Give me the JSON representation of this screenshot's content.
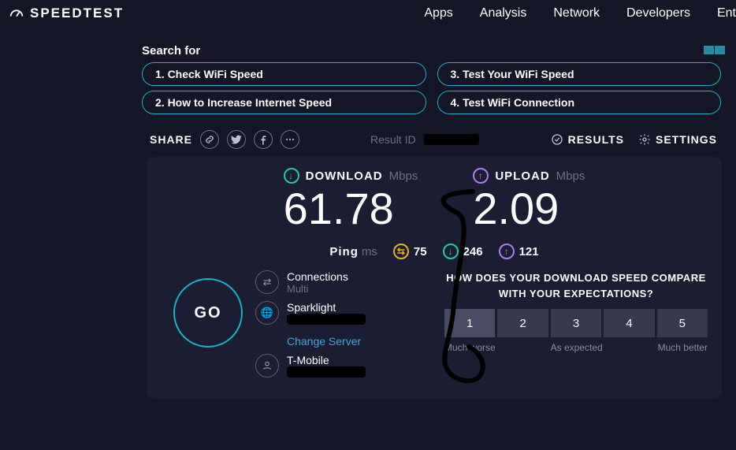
{
  "brand": "SPEEDTEST",
  "nav": {
    "apps": "Apps",
    "analysis": "Analysis",
    "network": "Network",
    "developers": "Developers",
    "enterprise": "Ent"
  },
  "search": {
    "title": "Search for",
    "items": [
      "1.  Check WiFi Speed",
      "3.  Test Your WiFi Speed",
      "2.  How to Increase Internet Speed",
      "4.  Test WiFi Connection"
    ]
  },
  "sharebar": {
    "share": "SHARE",
    "resultid": "Result ID",
    "results": "RESULTS",
    "settings": "SETTINGS"
  },
  "speed": {
    "download_label": "DOWNLOAD",
    "upload_label": "UPLOAD",
    "unit": "Mbps",
    "download": "61.78",
    "upload": "2.09"
  },
  "ping": {
    "label": "Ping",
    "unit": "ms",
    "idle": "75",
    "down": "246",
    "up": "121"
  },
  "go": "GO",
  "info": {
    "connections_label": "Connections",
    "connections_value": "Multi",
    "isp": "Sparklight",
    "change": "Change Server",
    "device": "T-Mobile"
  },
  "survey": {
    "question": "HOW DOES YOUR DOWNLOAD SPEED COMPARE WITH YOUR EXPECTATIONS?",
    "options": [
      "1",
      "2",
      "3",
      "4",
      "5"
    ],
    "low": "Much worse",
    "mid": "As expected",
    "high": "Much better"
  }
}
